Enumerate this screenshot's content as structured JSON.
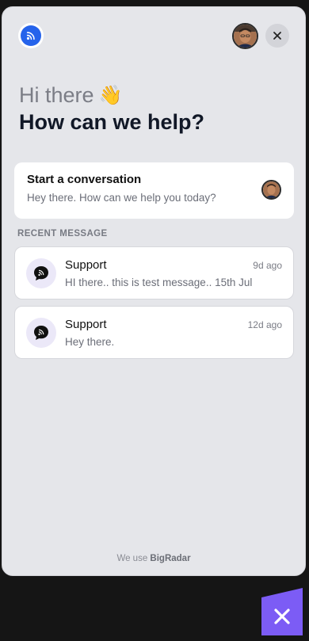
{
  "header": {
    "logo_icon": "chat-bubble-icon",
    "agent_avatar": "agent-avatar",
    "close_icon": "close-icon"
  },
  "greeting": {
    "line1": "Hi there",
    "wave": "👋",
    "line2": "How can we help?"
  },
  "start_conversation": {
    "title": "Start a conversation",
    "subtitle": "Hey there. How can we help you today?"
  },
  "recent": {
    "label": "RECENT MESSAGE",
    "messages": [
      {
        "name": "Support",
        "time": "9d ago",
        "text": "HI there.. this is test message.. 15th Jul"
      },
      {
        "name": "Support",
        "time": "12d ago",
        "text": "Hey there."
      }
    ]
  },
  "footer": {
    "prefix": "We use",
    "brand": "BigRadar"
  },
  "colors": {
    "brand_blue": "#2563eb",
    "launcher_purple": "#7c5cf5",
    "panel_bg": "#e5e6ea"
  }
}
